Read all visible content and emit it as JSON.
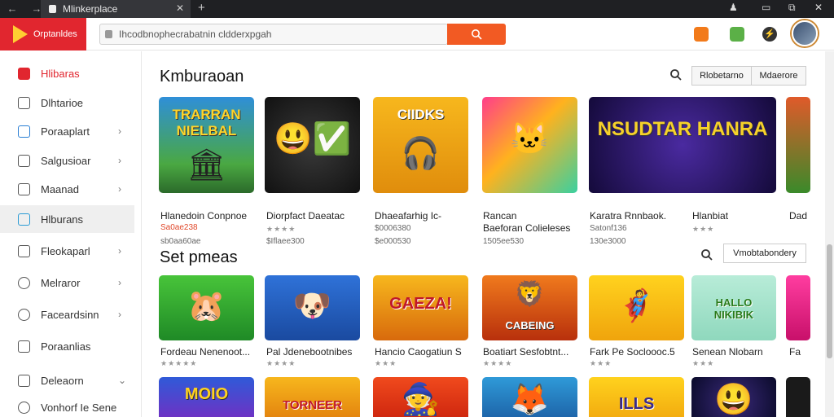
{
  "browser": {
    "tab_title": "Mlinkerplace",
    "back": "←",
    "forward": "→",
    "close": "✕",
    "new_tab": "+"
  },
  "header": {
    "logo_text": "Orptanldes",
    "search_placeholder": "Ihcodbnophecrabatnin cldderxpgah",
    "colors": {
      "brand": "#e1262f",
      "accent": "#f25a23"
    }
  },
  "sidebar": {
    "items": [
      {
        "label": "Hlibaras",
        "icon": "home-icon"
      },
      {
        "label": "Dlhtarioe",
        "icon": "tag-icon"
      },
      {
        "label": "Poraaplart",
        "icon": "user-icon"
      },
      {
        "label": "Salgusioar",
        "icon": "apps-icon"
      },
      {
        "label": "Maanad",
        "icon": "doc-icon"
      },
      {
        "label": "Hlburans",
        "icon": "grid-icon"
      },
      {
        "label": "Fleokaparl",
        "icon": "page-icon"
      },
      {
        "label": "Melraror",
        "icon": "profile-icon"
      },
      {
        "label": "Faceardsinn",
        "icon": "settings-icon"
      },
      {
        "label": "Poraanlias",
        "icon": "list-icon"
      },
      {
        "label": "Deleaorn",
        "icon": "chart-icon"
      },
      {
        "label": "Vonhorf Ie Sene",
        "icon": "info-icon"
      }
    ]
  },
  "section1": {
    "title": "Kmburaoan",
    "btn1": "Rlobetarno",
    "btn2": "Mdaerore",
    "cards": [
      {
        "art": "TRARRAN NIELBAL",
        "title": "Hlanedoin Conpnoe",
        "price": "Sa0ae238",
        "sub": "sb0aa60ae"
      },
      {
        "art": "",
        "title": "Diorpfact Daeatac",
        "price": "",
        "sub": "$Iflaee300"
      },
      {
        "art": "CIIDKS",
        "title": "Dhaeafarhig Ic-",
        "price": "$0006380",
        "sub": "$e000530"
      },
      {
        "art": "",
        "title": "Rancan",
        "price": "",
        "sub": "Baeforan Colieleses"
      },
      {
        "art": "NSUDTAR HANRA",
        "title": "Karatra Rnnbaok.",
        "price": "",
        "sub": "Satonf136"
      },
      {
        "art": "",
        "title": "Hlanbiat",
        "price": "",
        "sub": ""
      },
      {
        "art": "",
        "title": "Dad",
        "price": "",
        "sub": ""
      }
    ],
    "extra_subs": [
      "1505ee530",
      "130e3000"
    ]
  },
  "section2": {
    "title": "Set pmeas",
    "btn": "Vmobtabondery",
    "cards": [
      {
        "art": "",
        "title": "Fordeau Nenenoot..."
      },
      {
        "art": "",
        "title": "Pal Jdenebootnibes"
      },
      {
        "art": "GAEZA!",
        "title": "Hancio Caogatiun S"
      },
      {
        "art": "CABEING",
        "title": "Boatiart Sesfobtnt..."
      },
      {
        "art": "",
        "title": "Fark Pe Socloooc.5"
      },
      {
        "art": "HALLO NIKIBIK",
        "title": "Senean Nlobarn"
      },
      {
        "art": "",
        "title": "Fa"
      }
    ]
  },
  "section3": {
    "cards": [
      {
        "art": "MOIO"
      },
      {
        "art": "TORNEER"
      },
      {
        "art": ""
      },
      {
        "art": ""
      },
      {
        "art": "ILLS"
      },
      {
        "art": ""
      },
      {
        "art": ""
      }
    ]
  }
}
